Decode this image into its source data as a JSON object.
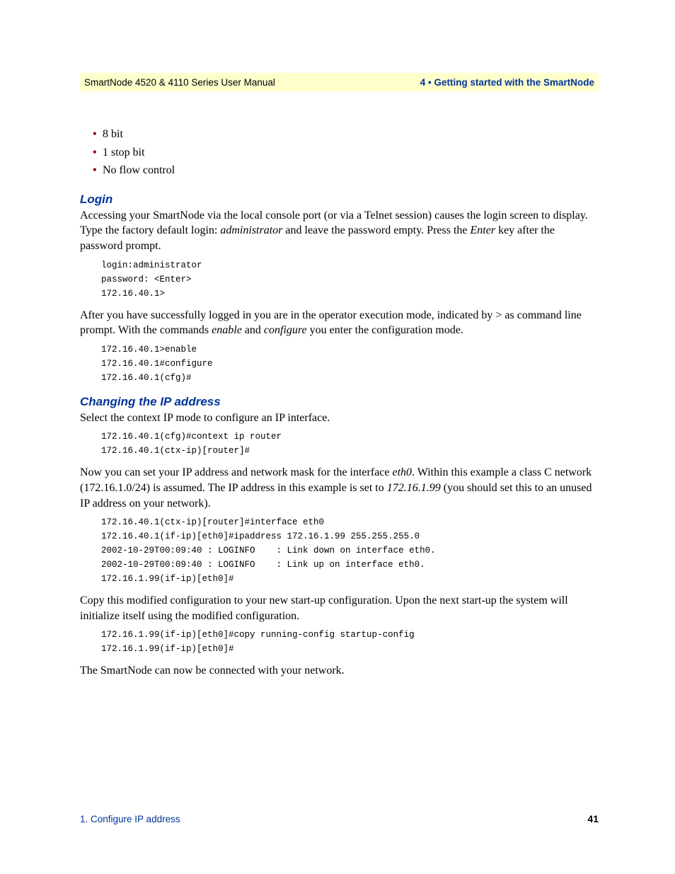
{
  "header": {
    "left": "SmartNode 4520 & 4110 Series User Manual",
    "right": "4 • Getting started with the SmartNode"
  },
  "bullets": [
    "8 bit",
    "1 stop bit",
    "No flow control"
  ],
  "login": {
    "heading": "Login",
    "p1a": "Accessing your SmartNode via the local console port (or via a Telnet session) causes the login screen to display. Type the factory default login: ",
    "p1_admin": "administrator",
    "p1b": " and leave the password empty. Press the ",
    "p1_enter": "Enter",
    "p1c": " key after the password prompt.",
    "code1": "login:administrator\npassword: <Enter>\n172.16.40.1>",
    "p2a": "After you have successfully logged in you are in the operator execution mode, indicated by > as command line prompt. With the commands ",
    "p2_enable": "enable",
    "p2b": " and ",
    "p2_configure": "configure",
    "p2c": " you enter the configuration mode.",
    "code2": "172.16.40.1>enable\n172.16.40.1#configure\n172.16.40.1(cfg)#"
  },
  "ip": {
    "heading": "Changing the IP address",
    "p1": "Select the context IP mode to configure an IP interface.",
    "code1": "172.16.40.1(cfg)#context ip router\n172.16.40.1(ctx-ip)[router]#",
    "p2a": "Now you can set your IP address and network mask for the interface ",
    "p2_eth0": "eth0",
    "p2b": ". Within this example a class C network (172.16.1.0/24) is assumed. The IP address in this example is set to ",
    "p2_ip": "172.16.1.99",
    "p2c": " (you should set this to an unused IP address on your network).",
    "code2": "172.16.40.1(ctx-ip)[router]#interface eth0\n172.16.40.1(if-ip)[eth0]#ipaddress 172.16.1.99 255.255.255.0\n2002-10-29T00:09:40 : LOGINFO    : Link down on interface eth0.\n2002-10-29T00:09:40 : LOGINFO    : Link up on interface eth0.\n172.16.1.99(if-ip)[eth0]#",
    "p3": "Copy this modified configuration to your new start-up configuration. Upon the next start-up the system will initialize itself using the modified configuration.",
    "code3": "172.16.1.99(if-ip)[eth0]#copy running-config startup-config\n172.16.1.99(if-ip)[eth0]#",
    "p4": "The SmartNode can now be connected with your network."
  },
  "footer": {
    "left": "1. Configure IP address",
    "right": "41"
  }
}
